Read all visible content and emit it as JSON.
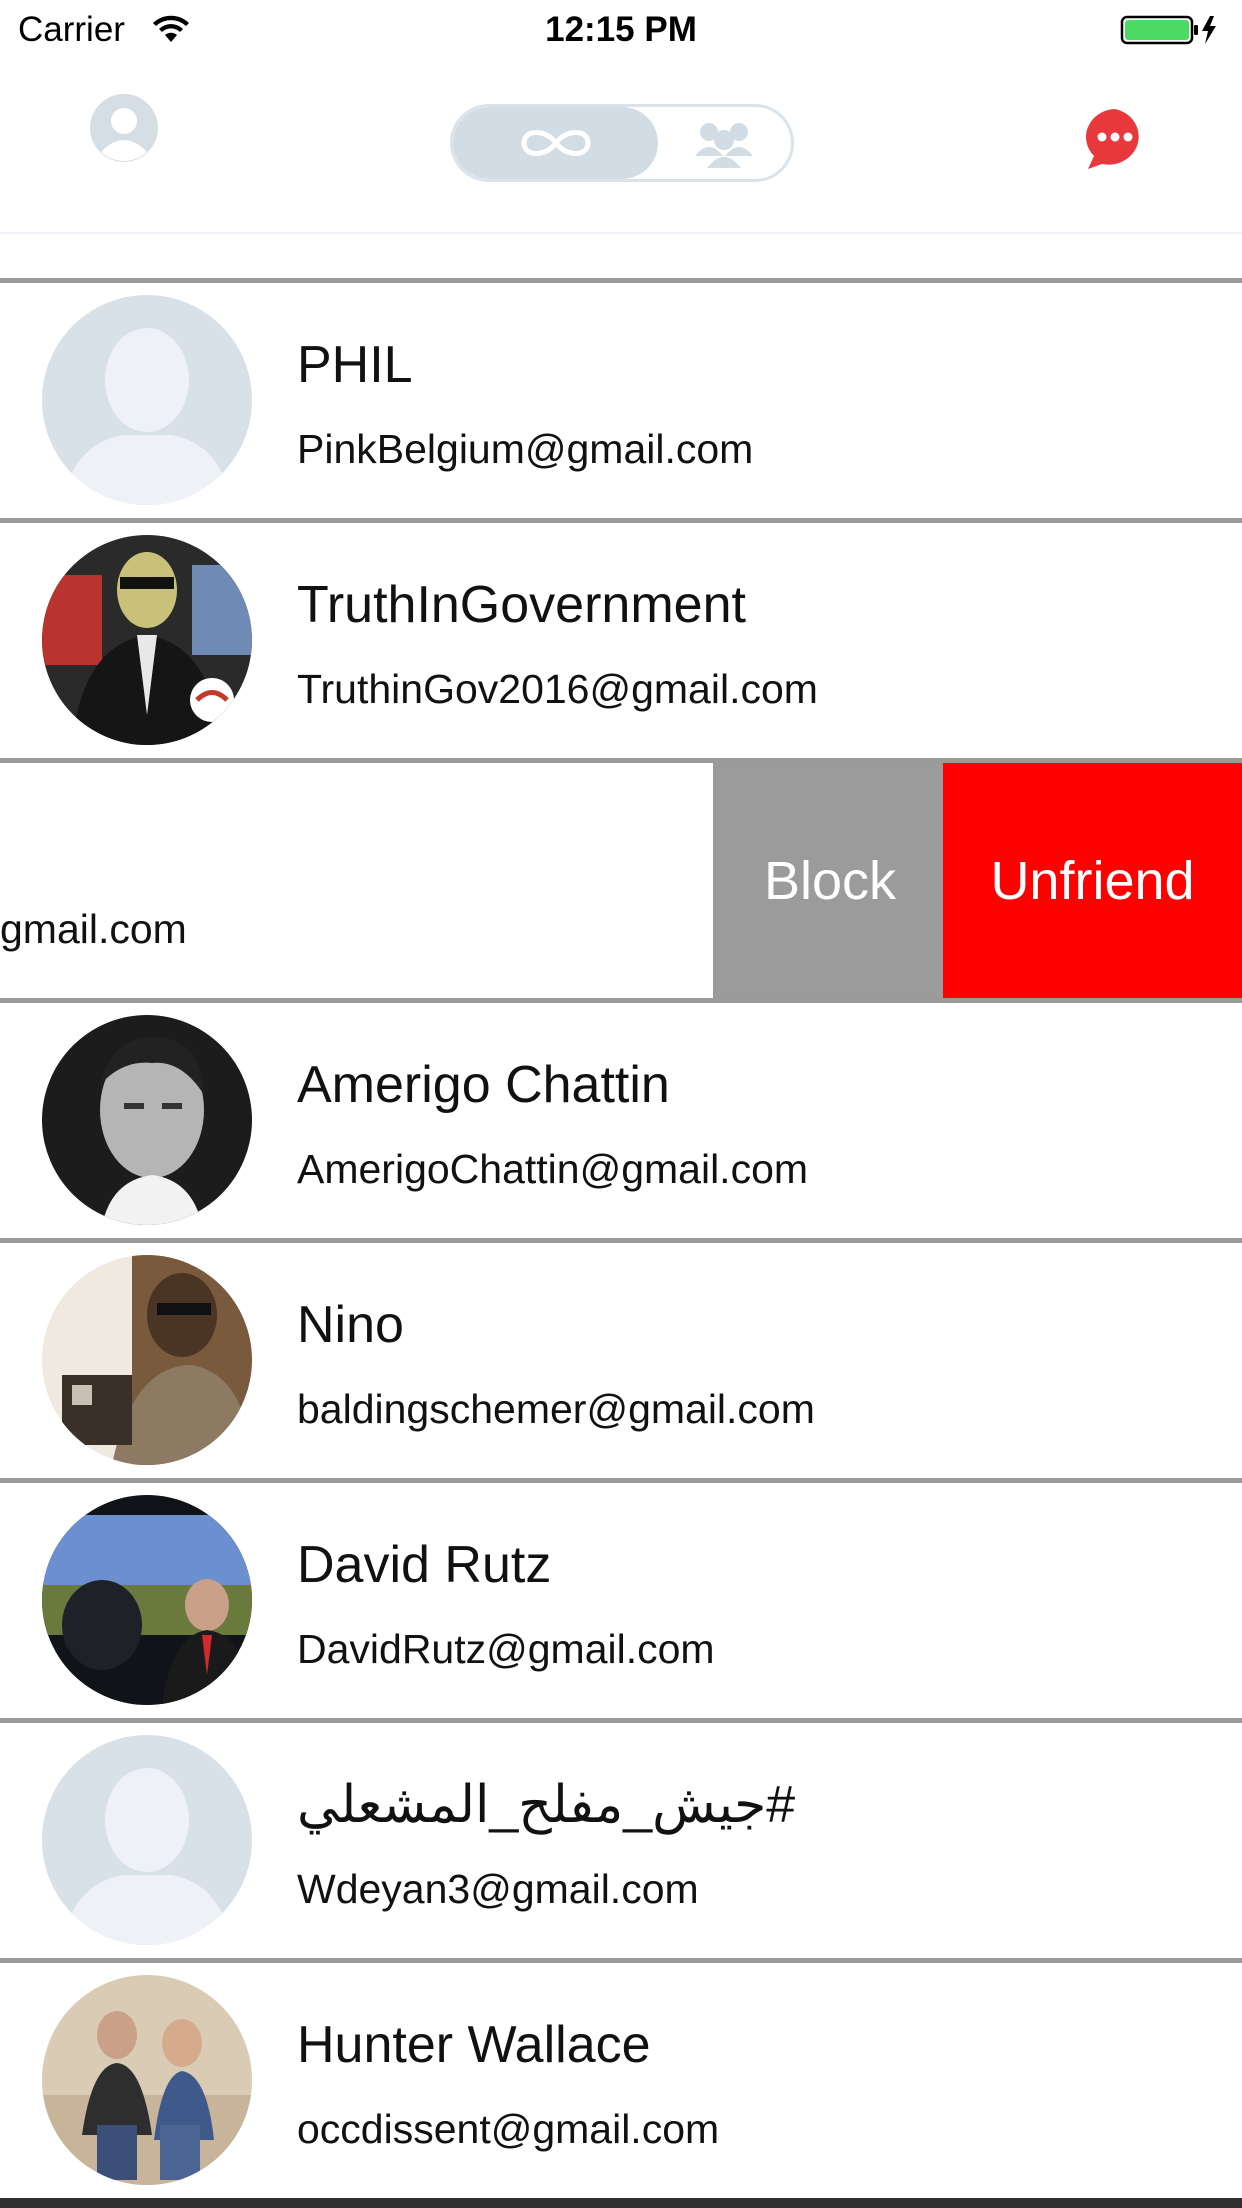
{
  "status_bar": {
    "carrier": "Carrier",
    "time": "12:15 PM",
    "battery_color": "#4cd964"
  },
  "nav": {
    "profile_icon": "person-icon",
    "segment_left_icon": "infinity-icon",
    "segment_right_icon": "group-icon",
    "chat_icon": "chat-bubble-icon",
    "accent_color": "#e8383b"
  },
  "friends": [
    {
      "name": "PHIL",
      "email": "PinkBelgium@gmail.com",
      "avatar": "placeholder"
    },
    {
      "name": "TruthInGovernment",
      "email": "TruthinGov2016@gmail.com",
      "avatar": "photo"
    },
    {
      "name": "",
      "email": "gmail.com",
      "avatar": "none"
    },
    {
      "name": "Amerigo Chattin",
      "email": "AmerigoChattin@gmail.com",
      "avatar": "photo"
    },
    {
      "name": "Nino",
      "email": "baldingschemer@gmail.com",
      "avatar": "photo"
    },
    {
      "name": "David Rutz",
      "email": "DavidRutz@gmail.com",
      "avatar": "photo"
    },
    {
      "name": "#جيش_مفلح_المشعلي",
      "email": "Wdeyan3@gmail.com",
      "avatar": "placeholder"
    },
    {
      "name": "Hunter Wallace",
      "email": "occdissent@gmail.com",
      "avatar": "photo"
    }
  ],
  "swipe_actions": {
    "block_label": "Block",
    "unfriend_label": "Unfriend",
    "block_color": "#9b9b9b",
    "unfriend_color": "#fe0000"
  }
}
